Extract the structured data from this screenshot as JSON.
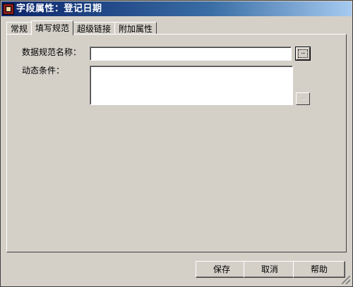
{
  "window": {
    "title": "字段属性：登记日期"
  },
  "tabs": [
    {
      "label": "常规",
      "active": false
    },
    {
      "label": "填写规范",
      "active": true
    },
    {
      "label": "超级链接",
      "active": false
    },
    {
      "label": "附加属性",
      "active": false
    }
  ],
  "form": {
    "spec_name_label": "数据规范名称：",
    "spec_name_value": "",
    "dynamic_label": "动态条件：",
    "dynamic_value": "",
    "browse_label": "...",
    "dynamic_browse_label": "..."
  },
  "buttons": {
    "save": "保存",
    "cancel": "取消",
    "help": "帮助"
  }
}
